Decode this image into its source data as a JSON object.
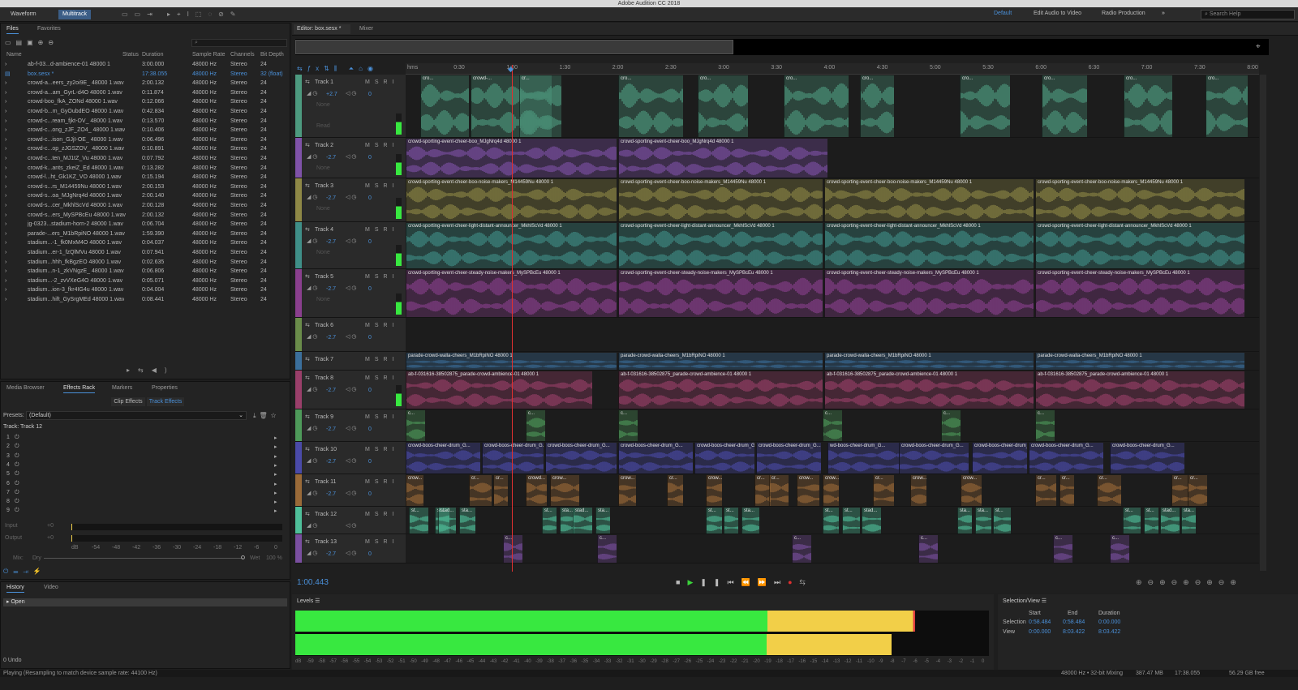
{
  "app_title": "Adobe Audition CC 2018",
  "toolbar": {
    "waveform": "Waveform",
    "multitrack": "Multitrack",
    "workspaces": [
      "Default",
      "Edit Audio to Video",
      "Radio Production"
    ],
    "search_placeholder": "Search Help"
  },
  "files_panel": {
    "tabs": [
      "Files",
      "Favorites"
    ],
    "columns": [
      "Name",
      "Status",
      "Duration",
      "Sample Rate",
      "Channels",
      "Bit Depth"
    ],
    "rows": [
      [
        "ab-f-03...d-ambience-01 48000 1",
        "",
        "3:00.000",
        "48000 Hz",
        "Stereo",
        "24"
      ],
      [
        "box.sesx *",
        "",
        "17:38.055",
        "48000 Hz",
        "Stereo",
        "32 (float)"
      ],
      [
        "crowd-a...eers_zy2oi9E_ 48000 1.wav",
        "",
        "2:00.132",
        "48000 Hz",
        "Stereo",
        "24"
      ],
      [
        "crowd-a...am_GyrL-d4O 48000 1.wav",
        "",
        "0:11.874",
        "48000 Hz",
        "Stereo",
        "24"
      ],
      [
        "crowd-boo_fkA_ZONd 48000 1.wav",
        "",
        "0:12.066",
        "48000 Hz",
        "Stereo",
        "24"
      ],
      [
        "crowd-b...m_GyOubdEO 48000 1.wav",
        "",
        "0:42.834",
        "48000 Hz",
        "Stereo",
        "24"
      ],
      [
        "crowd-c...ream_fjkt-OV_ 48000 1.wav",
        "",
        "0:13.570",
        "48000 Hz",
        "Stereo",
        "24"
      ],
      [
        "crowd-c...ong_zJF_ZO4_ 48000 1.wav",
        "",
        "0:10.406",
        "48000 Hz",
        "Stereo",
        "24"
      ],
      [
        "crowd-c...ison_GJjI-OE_ 48000 1.wav",
        "",
        "0:06.496",
        "48000 Hz",
        "Stereo",
        "24"
      ],
      [
        "crowd-c...op_zJGSZOV_ 48000 1.wav",
        "",
        "0:10.891",
        "48000 Hz",
        "Stereo",
        "24"
      ],
      [
        "crowd-c...ten_MJ1tZ_Vu 48000 1.wav",
        "",
        "0:07.792",
        "48000 Hz",
        "Stereo",
        "24"
      ],
      [
        "crowd-k...ants_zkeiZ_Ed 48000 1.wav",
        "",
        "0:13.282",
        "48000 Hz",
        "Stereo",
        "24"
      ],
      [
        "crowd-l...ht_Gk1KZ_VO 48000 1.wav",
        "",
        "0:15.194",
        "48000 Hz",
        "Stereo",
        "24"
      ],
      [
        "crowd-s...rs_M14459Nu 48000 1.wav",
        "",
        "2:00.153",
        "48000 Hz",
        "Stereo",
        "24"
      ],
      [
        "crowd-s...oa_MJgNrq4d 48000 1.wav",
        "",
        "2:00.140",
        "48000 Hz",
        "Stereo",
        "24"
      ],
      [
        "crowd-s...cer_MkhlScVd 48000 1.wav",
        "",
        "2:00.128",
        "48000 Hz",
        "Stereo",
        "24"
      ],
      [
        "crowd-s...ers_MySPBcEu 48000 1.wav",
        "",
        "2:00.132",
        "48000 Hz",
        "Stereo",
        "24"
      ],
      [
        "jg-0323...stadium-horn-2 48000 1.wav",
        "",
        "0:06.704",
        "48000 Hz",
        "Stereo",
        "24"
      ],
      [
        "parade-...ers_M1bRpiNO 48000 1.wav",
        "",
        "1:59.390",
        "48000 Hz",
        "Stereo",
        "24"
      ],
      [
        "stadium...-1_fk0MxM4O 48000 1.wav",
        "",
        "0:04.037",
        "48000 Hz",
        "Stereo",
        "24"
      ],
      [
        "stadium...er-1_fzQlMVu 48000 1.wav",
        "",
        "0:07.941",
        "48000 Hz",
        "Stereo",
        "24"
      ],
      [
        "stadium...hhh_fkBgzEO 48000 1.wav",
        "",
        "0:02.635",
        "48000 Hz",
        "Stereo",
        "24"
      ],
      [
        "stadium...n-1_zkVNgzE_ 48000 1.wav",
        "",
        "0:06.806",
        "48000 Hz",
        "Stereo",
        "24"
      ],
      [
        "stadium...-2_zvVXeG4O 48000 1.wav",
        "",
        "0:05.071",
        "48000 Hz",
        "Stereo",
        "24"
      ],
      [
        "stadium...ion-3_fkr4IG4u 48000 1.wav",
        "",
        "0:04.004",
        "48000 Hz",
        "Stereo",
        "24"
      ],
      [
        "stadium...hift_GySrgMEd 48000 1.wav",
        "",
        "0:08.441",
        "48000 Hz",
        "Stereo",
        "24"
      ]
    ]
  },
  "effects_panel": {
    "tabs": [
      "Media Browser",
      "Effects Rack",
      "Markers",
      "Properties"
    ],
    "subtabs": [
      "Clip Effects",
      "Track Effects"
    ],
    "presets_label": "Presets:",
    "preset_value": "(Default)",
    "track_label": "Track: Track 12",
    "slots": [
      "1",
      "2",
      "3",
      "4",
      "5",
      "6",
      "7",
      "8",
      "9"
    ],
    "input_label": "Input",
    "output_label": "Output",
    "input_db": "+0",
    "output_db": "+0",
    "mix_label": "Mix:",
    "dry": "Dry",
    "wet": "Wet",
    "wet_pct": "100 %",
    "meter_ticks": [
      "dB",
      "-54",
      "-48",
      "-42",
      "-36",
      "-30",
      "-24",
      "-18",
      "-12",
      "-6",
      "0"
    ]
  },
  "history_panel": {
    "tabs": [
      "History",
      "Video"
    ],
    "items": [
      "Open"
    ],
    "undo_count": "0 Undo"
  },
  "editor": {
    "tabs": [
      "Editor: box.sesx *",
      "Mixer"
    ],
    "ruler_ticks": [
      "hms",
      "0:30",
      "1:00",
      "1:30",
      "2:00",
      "2:30",
      "3:00",
      "3:30",
      "4:00",
      "4:30",
      "5:00",
      "5:30",
      "6:00",
      "6:30",
      "7:00",
      "7:30",
      "8:00"
    ],
    "timecode": "1:00.443",
    "tracks": [
      {
        "name": "Track 1",
        "vol": "+2.7",
        "pan": "0",
        "color": "#4d9a7f",
        "extra": [
          "None",
          "Read"
        ],
        "clips": [
          [
            "cro...",
            18,
            60
          ],
          [
            "crowd-...",
            80,
            100
          ],
          [
            "cr...",
            140,
            52
          ],
          [
            "cro...",
            262,
            80
          ],
          [
            "cro...",
            360,
            62
          ],
          [
            "cro...",
            466,
            80
          ],
          [
            "cro...",
            560,
            42
          ],
          [
            "cro...",
            683,
            62
          ],
          [
            "cro...",
            784,
            56
          ],
          [
            "cro...",
            885,
            60
          ],
          [
            "cro...",
            986,
            52
          ]
        ]
      },
      {
        "name": "Track 2",
        "vol": "-2.7",
        "pan": "0",
        "color": "#7f52a8",
        "extra": [
          "None"
        ],
        "clips": [
          [
            "crowd-sporting-event-cheer-boo_MJgNrq4d 48000 1",
            0,
            260
          ],
          [
            "crowd-sporting-event-cheer-boo_MJgNrq4d 48000 1",
            262,
            258
          ]
        ]
      },
      {
        "name": "Track 3",
        "vol": "-2.7",
        "pan": "0",
        "color": "#8e8846",
        "extra": [
          "None"
        ],
        "clips": [
          [
            "crowd-sporting-event-cheer-boo-noise-makers_M14459Nu 48000 1",
            0,
            260
          ],
          [
            "crowd-sporting-event-cheer-boo-noise-makers_M14459Nu 48000 1",
            262,
            252
          ],
          [
            "crowd-sporting-event-cheer-boo-noise-makers_M14459Nu 48000 1",
            516,
            258
          ],
          [
            "crowd-sporting-event-cheer-boo-noise-makers_M14459Nu 48000 1",
            776,
            258
          ]
        ]
      },
      {
        "name": "Track 4",
        "vol": "-2.7",
        "pan": "0",
        "color": "#3f8f88",
        "extra": [
          "None"
        ],
        "clips": [
          [
            "crowd-sporting-event-cheer-light-distant-announcer_MkhlScVd 48000 1",
            0,
            260
          ],
          [
            "crowd-sporting-event-cheer-light-distant-announcer_MkhlScVd 48000 1",
            262,
            252
          ],
          [
            "crowd-sporting-event-cheer-light-distant-announcer_MkhlScVd 48000 1",
            516,
            258
          ],
          [
            "crowd-sporting-event-cheer-light-distant-announcer_MkhlScVd 48000 1",
            776,
            258
          ]
        ]
      },
      {
        "name": "Track 5",
        "vol": "-2.7",
        "pan": "0",
        "color": "#8a3f8e",
        "extra": [
          "None"
        ],
        "clips": [
          [
            "crowd-sporting-event-cheer-steady-noise-makers_MySPBcEu 48000 1",
            0,
            260
          ],
          [
            "crowd-sporting-event-cheer-steady-noise-makers_MySPBcEu 48000 1",
            262,
            252
          ],
          [
            "crowd-sporting-event-cheer-steady-noise-makers_MySPBcEu 48000 1",
            516,
            258
          ],
          [
            "crowd-sporting-event-cheer-steady-noise-makers_MySPBcEu 48000 1",
            776,
            258
          ]
        ]
      },
      {
        "name": "Track 6",
        "vol": "-2.7",
        "pan": "0",
        "color": "#6a8c4a",
        "extra": [],
        "clips": []
      },
      {
        "name": "Track 7",
        "vol": "",
        "pan": "",
        "color": "#3b6f9c",
        "extra": [],
        "clips": [
          [
            "parade-crowd-walla-cheers_M1bRpiNO 48000 1",
            0,
            260
          ],
          [
            "parade-crowd-walla-cheers_M1bRpiNO 48000 1",
            262,
            252
          ],
          [
            "parade-crowd-walla-cheers_M1bRpiNO 48000 1",
            516,
            258
          ],
          [
            "parade-crowd-walla-cheers_M1bRpiNO 48000 1",
            776,
            258
          ]
        ]
      },
      {
        "name": "Track 8",
        "vol": "-2.7",
        "pan": "0",
        "color": "#9a3f6a",
        "extra": [],
        "clips": [
          [
            "ab-f-031616-38502875_parade-crowd-ambience-01 48000 1",
            0,
            230
          ],
          [
            "ab-f-031616-38502875_parade-crowd-ambience-01 48000 1",
            262,
            252
          ],
          [
            "ab-f-031616-38502875_parade-crowd-ambience-01 48000 1",
            516,
            258
          ],
          [
            "ab-f-031616-38502875_parade-crowd-ambience-01 48000 1",
            776,
            258
          ]
        ]
      },
      {
        "name": "Track 9",
        "vol": "-2.7",
        "pan": "0",
        "color": "#4e9a5a",
        "extra": [],
        "clips": [
          [
            "c...",
            0,
            24
          ],
          [
            "c...",
            148,
            24
          ],
          [
            "c...",
            262,
            24
          ],
          [
            "c...",
            514,
            24
          ],
          [
            "c...",
            660,
            24
          ],
          [
            "c...",
            776,
            24
          ]
        ]
      },
      {
        "name": "Track 10",
        "vol": "-2.7",
        "pan": "0",
        "color": "#4a4aa8",
        "extra": [],
        "clips": [
          [
            "crowd-boos-cheer-drum_G...",
            0,
            92
          ],
          [
            "crowd-boos-cheer-drum_G...",
            94,
            76
          ],
          [
            "crowd-boos-cheer-drum_G...",
            172,
            88
          ],
          [
            "crowd-boos-cheer-drum_G...",
            262,
            92
          ],
          [
            "crowd-boos-cheer-drum_G...",
            356,
            74
          ],
          [
            "crowd-boos-cheer-drum_G...",
            432,
            80
          ],
          [
            "wd-boos-cheer-drum_G...",
            520,
            88
          ],
          [
            "crowd-boos-cheer-drum_G...",
            608,
            86
          ],
          [
            "crowd-boos-cheer-drum_G...",
            698,
            68
          ],
          [
            "crowd-boos-cheer-drum_G...",
            768,
            92
          ],
          [
            "crowd-boos-cheer-drum_G...",
            868,
            92
          ]
        ]
      },
      {
        "name": "Track 11",
        "vol": "-2.7",
        "pan": "0",
        "color": "#9a6a38",
        "extra": [],
        "clips": [
          [
            "crow...",
            0,
            22
          ],
          [
            "cr...",
            78,
            28
          ],
          [
            "cr...",
            108,
            18
          ],
          [
            "crowd...",
            148,
            26
          ],
          [
            "crow...",
            178,
            36
          ],
          [
            "crow...",
            262,
            22
          ],
          [
            "cr...",
            322,
            20
          ],
          [
            "crow...",
            370,
            20
          ],
          [
            "cr...",
            430,
            20
          ],
          [
            "cr...",
            448,
            24
          ],
          [
            "crow...",
            482,
            28
          ],
          [
            "crow...",
            514,
            20
          ],
          [
            "cr...",
            576,
            26
          ],
          [
            "crow...",
            622,
            20
          ],
          [
            "crow...",
            684,
            26
          ],
          [
            "cr...",
            776,
            26
          ],
          [
            "cr...",
            806,
            18
          ],
          [
            "cr...",
            852,
            30
          ],
          [
            "cr...",
            944,
            20
          ],
          [
            "cr...",
            964,
            24
          ]
        ]
      },
      {
        "name": "Track 12",
        "vol": "",
        "pan": "",
        "color": "#4fbf9a",
        "extra": [],
        "clips": [
          [
            "st...",
            4,
            24
          ],
          [
            "st...",
            36,
            18
          ],
          [
            "stad...",
            40,
            22
          ],
          [
            "sta...",
            66,
            20
          ],
          [
            "st...",
            168,
            18
          ],
          [
            "sta...",
            190,
            18
          ],
          [
            "stad...",
            206,
            24
          ],
          [
            "sta...",
            234,
            18
          ],
          [
            "st...",
            370,
            20
          ],
          [
            "st...",
            392,
            18
          ],
          [
            "sta...",
            414,
            22
          ],
          [
            "st...",
            514,
            20
          ],
          [
            "st...",
            538,
            22
          ],
          [
            "stad...",
            562,
            24
          ],
          [
            "sta...",
            680,
            18
          ],
          [
            "sta...",
            702,
            20
          ],
          [
            "st...",
            724,
            22
          ],
          [
            "st...",
            884,
            22
          ],
          [
            "st...",
            910,
            18
          ],
          [
            "stad...",
            930,
            24
          ],
          [
            "sta...",
            956,
            18
          ]
        ]
      },
      {
        "name": "Track 13",
        "vol": "-2.7",
        "pan": "0",
        "color": "#7a4fa0",
        "extra": [],
        "clips": [
          [
            "c...",
            120,
            24
          ],
          [
            "c...",
            236,
            24
          ],
          [
            "c...",
            476,
            24
          ],
          [
            "c...",
            632,
            24
          ],
          [
            "c...",
            798,
            24
          ],
          [
            "c...",
            868,
            24
          ]
        ]
      }
    ]
  },
  "levels": {
    "title": "Levels",
    "ticks": [
      "dB",
      "-59",
      "-58",
      "-57",
      "-56",
      "-55",
      "-54",
      "-53",
      "-52",
      "-51",
      "-50",
      "-49",
      "-48",
      "-47",
      "-46",
      "-45",
      "-44",
      "-43",
      "-42",
      "-41",
      "-40",
      "-39",
      "-38",
      "-37",
      "-36",
      "-35",
      "-34",
      "-33",
      "-32",
      "-31",
      "-30",
      "-29",
      "-28",
      "-27",
      "-26",
      "-25",
      "-24",
      "-23",
      "-22",
      "-21",
      "-20",
      "-19",
      "-18",
      "-17",
      "-16",
      "-15",
      "-14",
      "-13",
      "-12",
      "-11",
      "-10",
      "-9",
      "-8",
      "-7",
      "-6",
      "-5",
      "-4",
      "-3",
      "-2",
      "-1",
      "0"
    ],
    "left_level_fraction": 0.893,
    "right_level_fraction": 0.86
  },
  "selection_view": {
    "title": "Selection/View",
    "headers": [
      "Start",
      "End",
      "Duration"
    ],
    "rows": [
      [
        "Selection",
        "0:58.484",
        "0:58.484",
        "0:00.000"
      ],
      [
        "View",
        "0:00.000",
        "8:03.422",
        "8:03.422"
      ]
    ]
  },
  "status": {
    "message": "Playing (Resampling to match device sample rate: 44100 Hz)",
    "right": [
      "48000 Hz • 32-bit Mixing",
      "387.47 MB",
      "17:38.055",
      "56.29 GB free"
    ]
  },
  "colors": {
    "accent": "#4a90d9",
    "playhead": "#e03030",
    "meter_green": "#38e840",
    "meter_yellow": "#f2cf48",
    "meter_red": "#e04040"
  }
}
